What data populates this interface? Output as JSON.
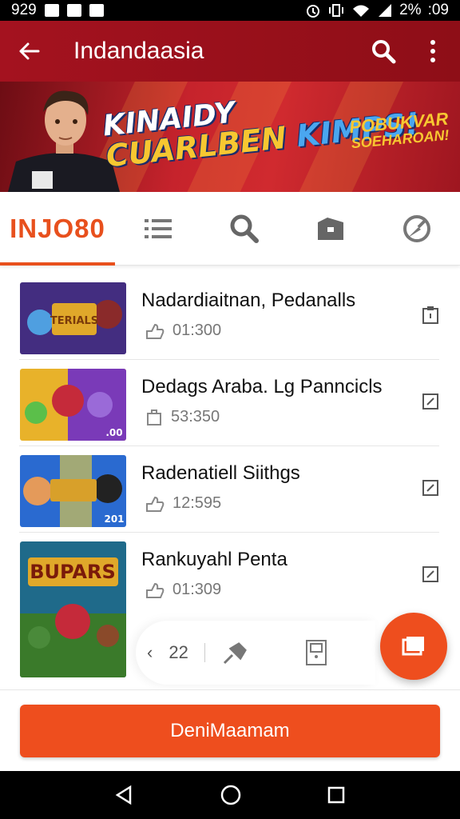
{
  "status_bar": {
    "time_left": "929",
    "battery": "2%",
    "time_right": ":09"
  },
  "app_bar": {
    "back": "←",
    "title": "Indandaasia"
  },
  "banner": {
    "title_line1": "KINAIDY",
    "title_line2a": "CUARLBEN",
    "title_line2b": "KIMPS!",
    "promo_line1": "POBUKVAR",
    "promo_line2": "SOEHAROAN!"
  },
  "tabs": {
    "main_label": "INJO80",
    "icons": [
      "list-icon",
      "search-icon",
      "folder-icon",
      "compass-icon"
    ]
  },
  "items": [
    {
      "name": "Nadardiaitnan, Pedanalls",
      "meta": "01:300",
      "thumb_text": "TERIALS"
    },
    {
      "name": "Dedags Araba. Lg Panncicls",
      "meta": "53:350",
      "thumb_text": ".00"
    },
    {
      "name": "Radenatiell Siithgs",
      "meta": "12:595",
      "thumb_text": "201"
    },
    {
      "name": "Rankuyahl Penta",
      "meta": "01:309",
      "thumb_text": "BUPARS"
    }
  ],
  "pager": {
    "prev": "‹",
    "page": "22"
  },
  "cta_label": "DeniMaamam",
  "colors": {
    "accent": "#ee4e1e",
    "app_bar": "#a4121f",
    "tab_active": "#e8501d"
  }
}
